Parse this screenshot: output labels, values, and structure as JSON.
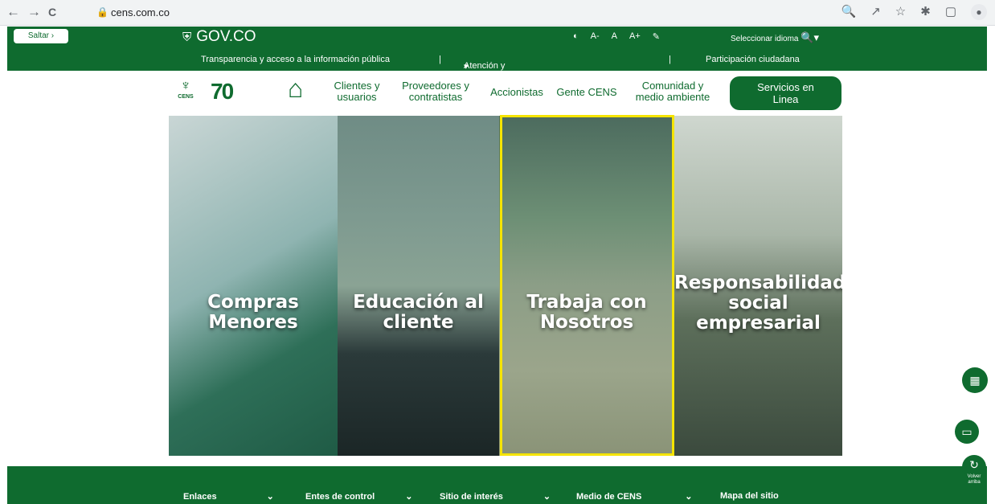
{
  "browser": {
    "url": "cens.com.co",
    "back_icon": "←",
    "forward_icon": "→",
    "reload_icon": "C",
    "lock_icon": "🔒",
    "zoom_icon": "🔍",
    "share_icon": "↗",
    "star_icon": "☆",
    "ext_icon": "✱",
    "split_icon": "▢",
    "profile_icon": "●"
  },
  "gov_bar": {
    "skip_label": "Saltar ›",
    "logo_text": "GOV.CO",
    "logo_icon": "⛨",
    "contrast_icon": "◐",
    "font_small": "A-",
    "font_normal": "A",
    "font_large": "A+",
    "pen_icon": "✎",
    "language_label": "Seleccionar idioma",
    "language_icon": "🔍▾"
  },
  "secondary_nav": {
    "transparency": "Transparencia y acceso a la información pública",
    "sep": "|",
    "atencion": "Atención y servicios a la ciudadanía",
    "chevron": "▾",
    "participacion": "Participación ciudadana"
  },
  "main_nav": {
    "logo_glyph": "♆",
    "logo_text": "CENS",
    "seventy": "70",
    "home_icon": "⌂",
    "items": [
      {
        "line1": "Clientes y",
        "line2": "usuarios"
      },
      {
        "line1": "Proveedores y",
        "line2": "contratistas"
      },
      {
        "line1": "Accionistas",
        "line2": ""
      },
      {
        "line1": "Gente CENS",
        "line2": ""
      },
      {
        "line1": "Comunidad y",
        "line2": "medio ambiente"
      }
    ],
    "services_line1": "Servicios en",
    "services_line2": "Linea"
  },
  "hero": {
    "panels": [
      {
        "line1": "Compras",
        "line2": "Menores",
        "line3": ""
      },
      {
        "line1": "Educación al",
        "line2": "cliente",
        "line3": ""
      },
      {
        "line1": "Trabaja con",
        "line2": "Nosotros",
        "line3": ""
      },
      {
        "line1": "Responsabilidad",
        "line2": "social",
        "line3": "empresarial"
      }
    ]
  },
  "footer": {
    "items": [
      {
        "label": "Enlaces",
        "chev": "⌄"
      },
      {
        "label": "Entes de control",
        "chev": "⌄"
      },
      {
        "label": "Sitio de interés",
        "chev": "⌄"
      },
      {
        "label": "Medio de CENS",
        "chev": "⌄"
      },
      {
        "label": "Mapa del sitio",
        "chev": ""
      }
    ]
  },
  "floating": {
    "calendar_icon": "▦",
    "chat_icon": "▭",
    "back_top_icon": "↻",
    "back_top_label": "Volver arriba"
  },
  "colors": {
    "brand_green": "#0f6b2f",
    "highlight": "#f5e400"
  }
}
